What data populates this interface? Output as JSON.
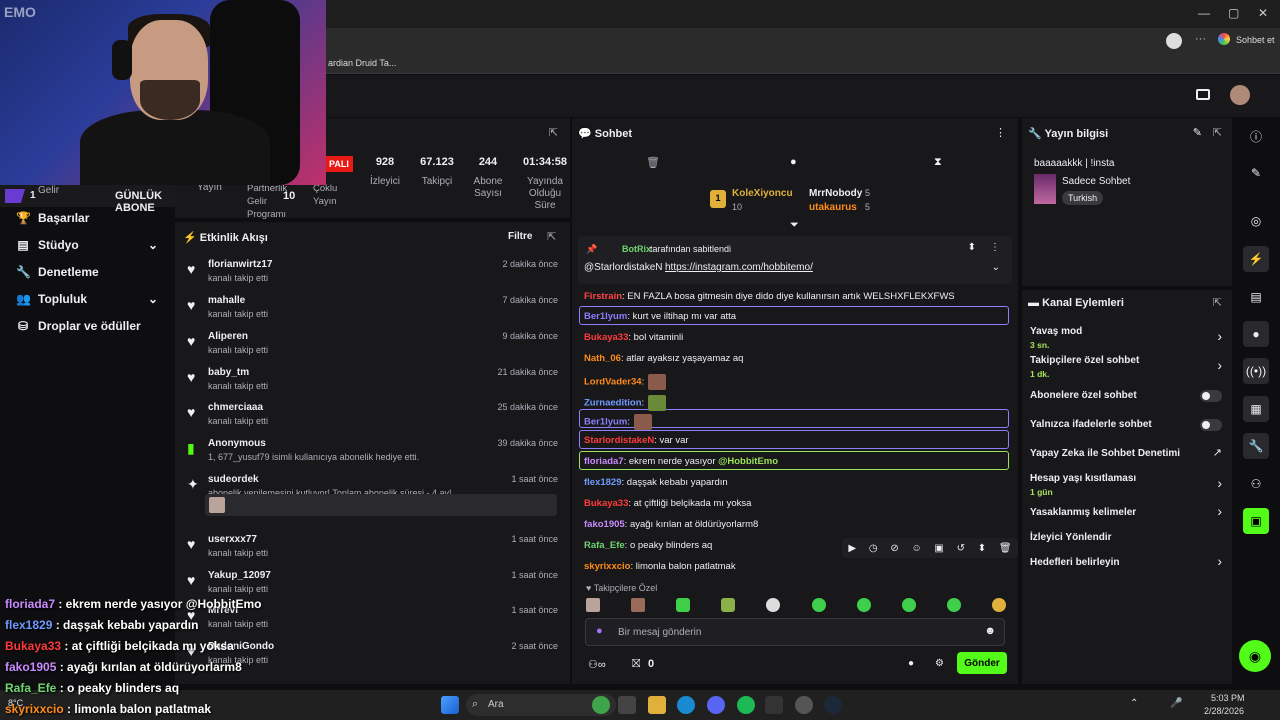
{
  "browser": {
    "bookmark": "ardian Druid Ta...",
    "chat_label": "Sohbet et",
    "win_controls": [
      "—",
      "▢",
      "✕"
    ]
  },
  "webcam": {
    "logo": "EMO"
  },
  "stats": {
    "badge": "PALI",
    "items": [
      {
        "value": "928",
        "label": "İzleyici"
      },
      {
        "value": "67.123",
        "label": "Takipçi"
      },
      {
        "value": "244",
        "label": "Abone Sayısı"
      },
      {
        "value": "01:34:58",
        "label": "Yayında Olduğu Süre"
      }
    ],
    "partial_labels": {
      "yayin": "Yayın",
      "partner": "Partnerlik Gelir Programı",
      "coklu": "Çoklu Yayın",
      "gelir": "Gelir",
      "partner_value": "10"
    },
    "daily_sub_count": "1",
    "daily_sub_label": "GÜNLÜK ABONE"
  },
  "leftnav": {
    "items": [
      {
        "label": "Başarılar"
      },
      {
        "label": "Stüdyo"
      },
      {
        "label": "Denetleme"
      },
      {
        "label": "Topluluk"
      },
      {
        "label": "Droplar ve ödüller"
      }
    ]
  },
  "feed": {
    "title": "Etkinlik Akışı",
    "filter": "Filtre",
    "rows": [
      {
        "name": "florianwirtz17",
        "sub": "kanalı takip etti",
        "time": "2 dakika önce"
      },
      {
        "name": "mahalle",
        "sub": "kanalı takip etti",
        "time": "7 dakika önce"
      },
      {
        "name": "Aliperen",
        "sub": "kanalı takip etti",
        "time": "9 dakika önce"
      },
      {
        "name": "baby_tm",
        "sub": "kanalı takip etti",
        "time": "21 dakika önce"
      },
      {
        "name": "chmerciaaa",
        "sub": "kanalı takip etti",
        "time": "25 dakika önce"
      },
      {
        "name": "Anonymous",
        "sub": "1, 677_yusuf79 isimli kullanıcıya abonelik hediye etti.",
        "time": "39 dakika önce"
      },
      {
        "name": "sudeordek",
        "sub": "abonelik yenilemesini kutluyor! Toplam abonelik süresi - 4 ay!",
        "time": "1 saat önce"
      },
      {
        "name": "userxxx77",
        "sub": "kanalı takip etti",
        "time": "1 saat önce"
      },
      {
        "name": "Yakup_12097",
        "sub": "kanalı takip etti",
        "time": "1 saat önce"
      },
      {
        "name": "Mrrevi",
        "sub": "kanalı takip etti",
        "time": "1 saat önce"
      },
      {
        "name": "DadoniGondo",
        "sub": "kanalı takip etti",
        "time": "2 saat önce"
      }
    ]
  },
  "chat": {
    "title": "Sohbet",
    "leaders": [
      {
        "name": "KoleXiyoncu",
        "count": "10"
      },
      {
        "name": "MrrNobody",
        "count": "5"
      },
      {
        "name": "utakaurus",
        "count": "5"
      }
    ],
    "pinned": {
      "by": "BotRix",
      "by_suffix": "tarafından sabitlendi",
      "text": "@StarlordistakeN",
      "link": "https://instagram.com/hobbitemo/"
    },
    "messages": [
      {
        "user": "Firstrain",
        "color": "#ff4444",
        "text": ": EN FAZLA bosa gitmesin diye dido diye kullanırsın artık WELSHXFLEKXFWS"
      },
      {
        "user": "Ber1lyum",
        "color": "#8a7fff",
        "text": ": kurt ve iltihap mı var atta"
      },
      {
        "user": "Bukaya33",
        "color": "#ff3b3b",
        "text": ": bol vitaminli"
      },
      {
        "user": "Nath_06",
        "color": "#ff8c1a",
        "text": ": atlar ayaksız yaşayamaz aq"
      },
      {
        "user": "LordVader34",
        "color": "#ff8c1a",
        "text": ":"
      },
      {
        "user": "Zurnaedition",
        "color": "#6f9bff",
        "text": ":"
      },
      {
        "user": "Ber1lyum",
        "color": "#8a7fff",
        "text": ":"
      },
      {
        "user": "StarlordistakeN",
        "color": "#ff3b3b",
        "text": ": var var"
      },
      {
        "user": "floriada7",
        "color": "#c98bff",
        "text": ": ekrem nerde yasıyor ",
        "mention": "@HobbitEmo"
      },
      {
        "user": "flex1829",
        "color": "#6f9bff",
        "text": ": daşşak kebabı yapardın"
      },
      {
        "user": "Bukaya33",
        "color": "#ff3b3b",
        "text": ": at çiftliği belçikada mı yoksa"
      },
      {
        "user": "fako1905",
        "color": "#c98bff",
        "text": ": ayağı kırılan at öldürüyorlarm8"
      },
      {
        "user": "Rafa_Efe",
        "color": "#6fd66f",
        "text": ": o peaky blinders aq"
      },
      {
        "user": "skyrixxcio",
        "color": "#ff8c1a",
        "text": ": limonla balon patlatmak"
      }
    ],
    "followers_label": "Takipçilere Özel",
    "input_placeholder": "Bir mesaj gönderin",
    "points": "0",
    "send": "Gönder"
  },
  "info": {
    "title": "Yayın bilgisi",
    "stream_title": "baaaaakkk | !insta",
    "category": "Sadece Sohbet",
    "tag": "Turkish"
  },
  "actions": {
    "title": "Kanal Eylemleri",
    "items": [
      {
        "label": "Yavaş mod",
        "sub": "3 sn."
      },
      {
        "label": "Takipçilere özel sohbet",
        "sub": "1 dk."
      },
      {
        "label": "Abonelere özel sohbet",
        "sub": ""
      },
      {
        "label": "Yalnızca ifadelerle sohbet",
        "sub": ""
      },
      {
        "label": "Yapay Zeka ile Sohbet Denetimi",
        "sub": ""
      },
      {
        "label": "Hesap yaşı kısıtlaması",
        "sub": "1 gün"
      },
      {
        "label": "Yasaklanmış kelimeler",
        "sub": ""
      },
      {
        "label": "İzleyici Yönlendir",
        "sub": ""
      },
      {
        "label": "Hedefleri belirleyin",
        "sub": ""
      }
    ]
  },
  "overlay": {
    "lines": [
      {
        "user": "floriada7",
        "color": "#c98bff",
        "text": " : ekrem nerde yasıyor @HobbitEmo"
      },
      {
        "user": "flex1829",
        "color": "#6f9bff",
        "text": " : daşşak kebabı yapardın"
      },
      {
        "user": "Bukaya33",
        "color": "#ff3b3b",
        "text": " : at çiftliği belçikada mı yoksa"
      },
      {
        "user": "fako1905",
        "color": "#c98bff",
        "text": " : ayağı kırılan at öldürüyorlarm8"
      },
      {
        "user": "Rafa_Efe",
        "color": "#6fd66f",
        "text": " : o peaky blinders aq"
      },
      {
        "user": "skyrixxcio",
        "color": "#ff8c1a",
        "text": " : limonla balon patlatmak"
      }
    ]
  },
  "taskbar": {
    "search": "Ara",
    "time": "5:03 PM",
    "date": "2/28/2026",
    "temp": "8°C"
  }
}
